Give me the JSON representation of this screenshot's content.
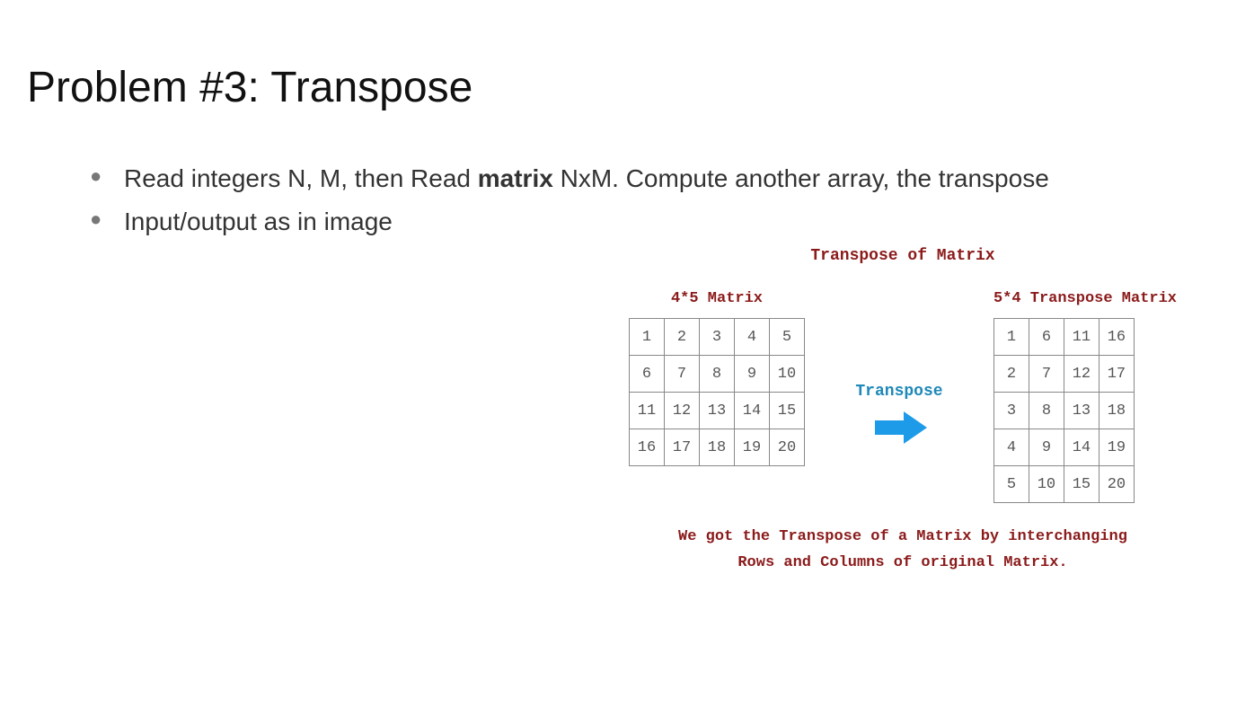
{
  "title": "Problem #3: Transpose",
  "bullets": {
    "b1_pre": "Read integers N, M, then Read ",
    "b1_bold": "matrix",
    "b1_post": " NxM. Compute another array, the transpose",
    "b2": "Input/output as in image"
  },
  "diagram": {
    "heading": "Transpose of Matrix",
    "left_label": "4*5 Matrix",
    "right_label": "5*4 Transpose Matrix",
    "arrow_label": "Transpose",
    "footer_l1": "We got the Transpose of a Matrix by interchanging",
    "footer_l2": "Rows and Columns of original Matrix."
  },
  "chart_data": {
    "type": "table",
    "title": "Transpose of Matrix",
    "input_label": "4*5 Matrix",
    "output_label": "5*4 Transpose Matrix",
    "input_rows": 4,
    "input_cols": 5,
    "input_matrix": [
      [
        1,
        2,
        3,
        4,
        5
      ],
      [
        6,
        7,
        8,
        9,
        10
      ],
      [
        11,
        12,
        13,
        14,
        15
      ],
      [
        16,
        17,
        18,
        19,
        20
      ]
    ],
    "output_rows": 5,
    "output_cols": 4,
    "output_matrix": [
      [
        1,
        6,
        11,
        16
      ],
      [
        2,
        7,
        12,
        17
      ],
      [
        3,
        8,
        13,
        18
      ],
      [
        4,
        9,
        14,
        19
      ],
      [
        5,
        10,
        15,
        20
      ]
    ],
    "caption": "We got the Transpose of a Matrix by interchanging Rows and Columns of original Matrix."
  }
}
